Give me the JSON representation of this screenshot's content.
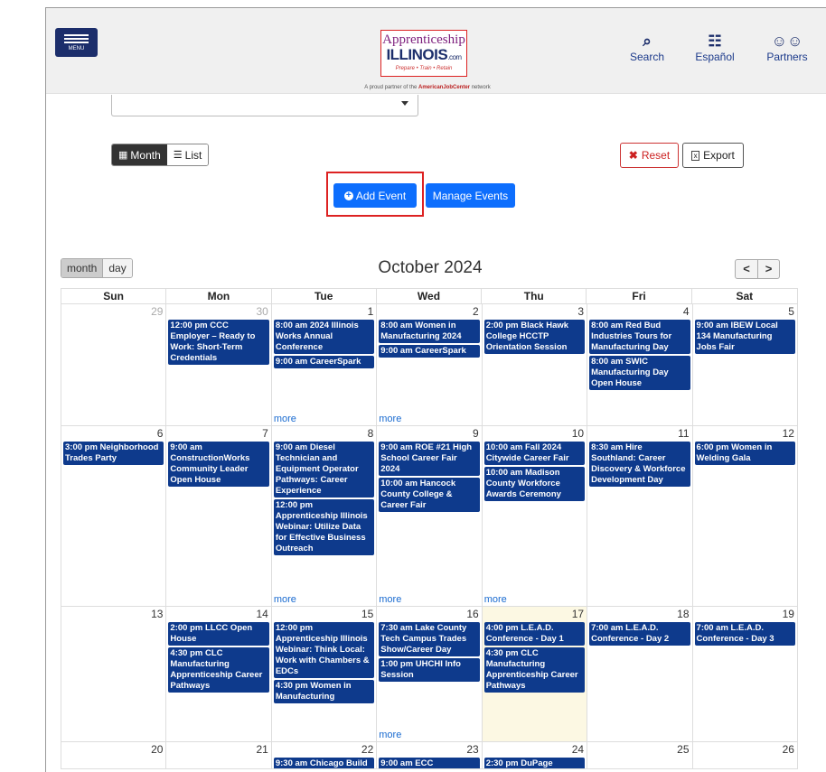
{
  "header": {
    "menu_label": "MENU",
    "logo_line1": "Apprenticeship",
    "logo_line2": "ILLINOIS",
    "logo_suffix": ".com",
    "logo_tagline": "Prepare • Train • Retain",
    "partner_pre": "A proud partner of the ",
    "partner_brand": "AmericanJobCenter",
    "partner_post": " network",
    "links": [
      {
        "label": "Search",
        "icon": "search-icon"
      },
      {
        "label": "Español",
        "icon": "translate-icon"
      },
      {
        "label": "Partners",
        "icon": "partners-icon"
      }
    ]
  },
  "toolbar": {
    "month_label": "Month",
    "list_label": "List",
    "reset_label": "Reset",
    "export_label": "Export",
    "add_event_label": "Add Event",
    "manage_events_label": "Manage Events"
  },
  "calendar": {
    "title": "October 2024",
    "view_month": "month",
    "view_day": "day",
    "prev": "<",
    "next": ">",
    "more_label": "more",
    "days_of_week": [
      "Sun",
      "Mon",
      "Tue",
      "Wed",
      "Thu",
      "Fri",
      "Sat"
    ],
    "weeks": [
      {
        "days": [
          {
            "num": "29",
            "other": true,
            "events": []
          },
          {
            "num": "30",
            "other": true,
            "events": [
              "12:00 pm CCC Employer – Ready to Work: Short-Term Credentials"
            ]
          },
          {
            "num": "1",
            "events": [
              "8:00 am 2024 Illinois Works Annual Conference",
              "9:00 am CareerSpark"
            ],
            "more": true
          },
          {
            "num": "2",
            "events": [
              "8:00 am Women in Manufacturing 2024",
              "9:00 am CareerSpark"
            ],
            "more": true
          },
          {
            "num": "3",
            "events": [
              "2:00 pm Black Hawk College HCCTP Orientation Session"
            ]
          },
          {
            "num": "4",
            "events": [
              "8:00 am Red Bud Industries Tours for Manufacturing Day",
              "8:00 am SWIC Manufacturing Day Open House"
            ]
          },
          {
            "num": "5",
            "events": [
              "9:00 am IBEW Local 134 Manufacturing Jobs Fair"
            ]
          }
        ]
      },
      {
        "days": [
          {
            "num": "6",
            "events": [
              "3:00 pm Neighborhood Trades Party"
            ]
          },
          {
            "num": "7",
            "events": [
              "9:00 am ConstructionWorks Community Leader Open House"
            ]
          },
          {
            "num": "8",
            "events": [
              "9:00 am Diesel Technician and Equipment Operator Pathways: Career Experience",
              "12:00 pm Apprenticeship Illinois Webinar: Utilize Data for Effective Business Outreach"
            ],
            "more": true
          },
          {
            "num": "9",
            "events": [
              "9:00 am ROE #21 High School Career Fair 2024",
              "10:00 am Hancock County College & Career Fair"
            ],
            "more": true
          },
          {
            "num": "10",
            "events": [
              "10:00 am Fall 2024 Citywide Career Fair",
              "10:00 am Madison County Workforce Awards Ceremony"
            ],
            "more": true
          },
          {
            "num": "11",
            "events": [
              "8:30 am Hire Southland: Career Discovery & Workforce Development Day"
            ]
          },
          {
            "num": "12",
            "events": [
              "6:00 pm Women in Welding Gala"
            ]
          }
        ]
      },
      {
        "days": [
          {
            "num": "13",
            "events": []
          },
          {
            "num": "14",
            "events": [
              "2:00 pm LLCC Open House",
              "4:30 pm CLC Manufacturing Apprenticeship Career Pathways"
            ]
          },
          {
            "num": "15",
            "events": [
              "12:00 pm Apprenticeship Illinois Webinar: Think Local: Work with Chambers & EDCs",
              "4:30 pm Women in Manufacturing"
            ]
          },
          {
            "num": "16",
            "events": [
              "7:30 am Lake County Tech Campus Trades Show/Career Day",
              "1:00 pm UHCHI Info Session"
            ],
            "more": true
          },
          {
            "num": "17",
            "today": true,
            "events": [
              "4:00 pm L.E.A.D. Conference - Day 1",
              "4:30 pm CLC Manufacturing Apprenticeship Career Pathways"
            ]
          },
          {
            "num": "18",
            "events": [
              "7:00 am L.E.A.D. Conference - Day 2"
            ]
          },
          {
            "num": "19",
            "events": [
              "7:00 am L.E.A.D. Conference - Day 3"
            ]
          }
        ]
      },
      {
        "days": [
          {
            "num": "20",
            "events": []
          },
          {
            "num": "21",
            "events": []
          },
          {
            "num": "22",
            "events": [
              "9:30 am Chicago Build"
            ]
          },
          {
            "num": "23",
            "events": [
              "9:00 am ECC"
            ]
          },
          {
            "num": "24",
            "events": [
              "2:30 pm DuPage"
            ]
          },
          {
            "num": "25",
            "events": []
          },
          {
            "num": "26",
            "events": []
          }
        ]
      }
    ]
  },
  "colors": {
    "event_bg": "#0e3a8c",
    "primary_button": "#0d6efd",
    "today_bg": "#fcf8e3",
    "highlight": "#dd2222"
  }
}
